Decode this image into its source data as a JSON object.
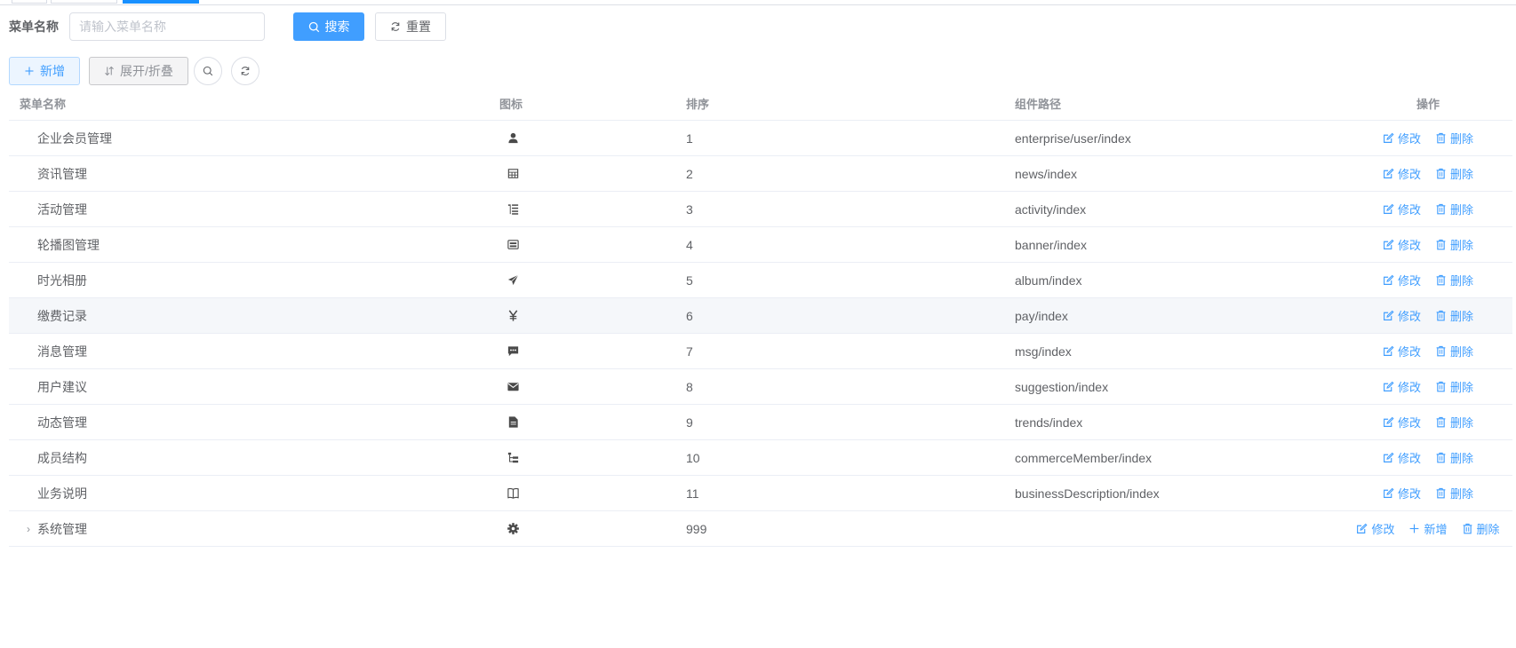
{
  "search": {
    "label": "菜单名称",
    "placeholder": "请输入菜单名称",
    "value": "",
    "search_btn": "搜索",
    "reset_btn": "重置"
  },
  "toolbar": {
    "add_btn": "新增",
    "toggle_btn": "展开/折叠"
  },
  "table": {
    "headers": {
      "name": "菜单名称",
      "icon": "图标",
      "sort": "排序",
      "path": "组件路径",
      "ops": "操作"
    },
    "ops": {
      "edit": "修改",
      "add": "新增",
      "delete": "删除"
    },
    "rows": [
      {
        "name": "企业会员管理",
        "icon": "user-icon",
        "sort": "1",
        "path": "enterprise/user/index"
      },
      {
        "name": "资讯管理",
        "icon": "table-icon",
        "sort": "2",
        "path": "news/index"
      },
      {
        "name": "活动管理",
        "icon": "list-tree-icon",
        "sort": "3",
        "path": "activity/index"
      },
      {
        "name": "轮播图管理",
        "icon": "gallery-icon",
        "sort": "4",
        "path": "banner/index"
      },
      {
        "name": "时光相册",
        "icon": "paper-plane-icon",
        "sort": "5",
        "path": "album/index"
      },
      {
        "name": "缴费记录",
        "icon": "yen-icon",
        "sort": "6",
        "path": "pay/index"
      },
      {
        "name": "消息管理",
        "icon": "message-icon",
        "sort": "7",
        "path": "msg/index"
      },
      {
        "name": "用户建议",
        "icon": "mail-icon",
        "sort": "8",
        "path": "suggestion/index"
      },
      {
        "name": "动态管理",
        "icon": "document-icon",
        "sort": "9",
        "path": "trends/index"
      },
      {
        "name": "成员结构",
        "icon": "tree-icon",
        "sort": "10",
        "path": "commerceMember/index"
      },
      {
        "name": "业务说明",
        "icon": "book-icon",
        "sort": "11",
        "path": "businessDescription/index"
      },
      {
        "name": "系统管理",
        "icon": "gear-icon",
        "sort": "999",
        "path": ""
      }
    ]
  },
  "colors": {
    "primary": "#409eff",
    "hover_row": "#f5f7fa",
    "border": "#ebeef5"
  }
}
